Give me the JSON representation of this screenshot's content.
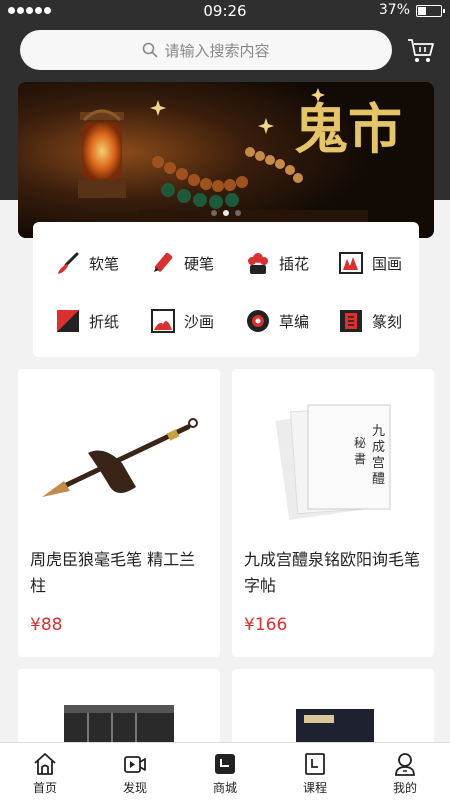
{
  "status_bar": {
    "time": "09:26",
    "battery_percent": "37%"
  },
  "search": {
    "placeholder": "请输入搜索内容"
  },
  "banner": {
    "title": "鬼市",
    "slide_count": 3,
    "active_slide": 2
  },
  "categories": [
    {
      "label": "软笔",
      "icon": "brush-icon"
    },
    {
      "label": "硬笔",
      "icon": "pen-icon"
    },
    {
      "label": "插花",
      "icon": "flower-arrangement-icon"
    },
    {
      "label": "国画",
      "icon": "chinese-painting-icon"
    },
    {
      "label": "折纸",
      "icon": "origami-icon"
    },
    {
      "label": "沙画",
      "icon": "sand-painting-icon"
    },
    {
      "label": "草编",
      "icon": "grass-weaving-icon"
    },
    {
      "label": "篆刻",
      "icon": "seal-carving-icon"
    }
  ],
  "products": [
    {
      "name": "周虎臣狼毫毛笔 精工兰柱",
      "price": "¥88"
    },
    {
      "name": "九成宫醴泉铭欧阳询毛笔字帖",
      "price": "¥166"
    },
    {
      "name": "",
      "price": ""
    },
    {
      "name": "",
      "price": ""
    }
  ],
  "tabbar": [
    {
      "label": "首页",
      "icon": "home-icon",
      "active": false
    },
    {
      "label": "发现",
      "icon": "discover-video-icon",
      "active": false
    },
    {
      "label": "商城",
      "icon": "mall-icon",
      "active": true
    },
    {
      "label": "课程",
      "icon": "course-icon",
      "active": false
    },
    {
      "label": "我的",
      "icon": "profile-icon",
      "active": false
    }
  ],
  "colors": {
    "header_bg": "#2f2f2f",
    "accent_red": "#d93030",
    "page_bg": "#f2f2f2"
  }
}
